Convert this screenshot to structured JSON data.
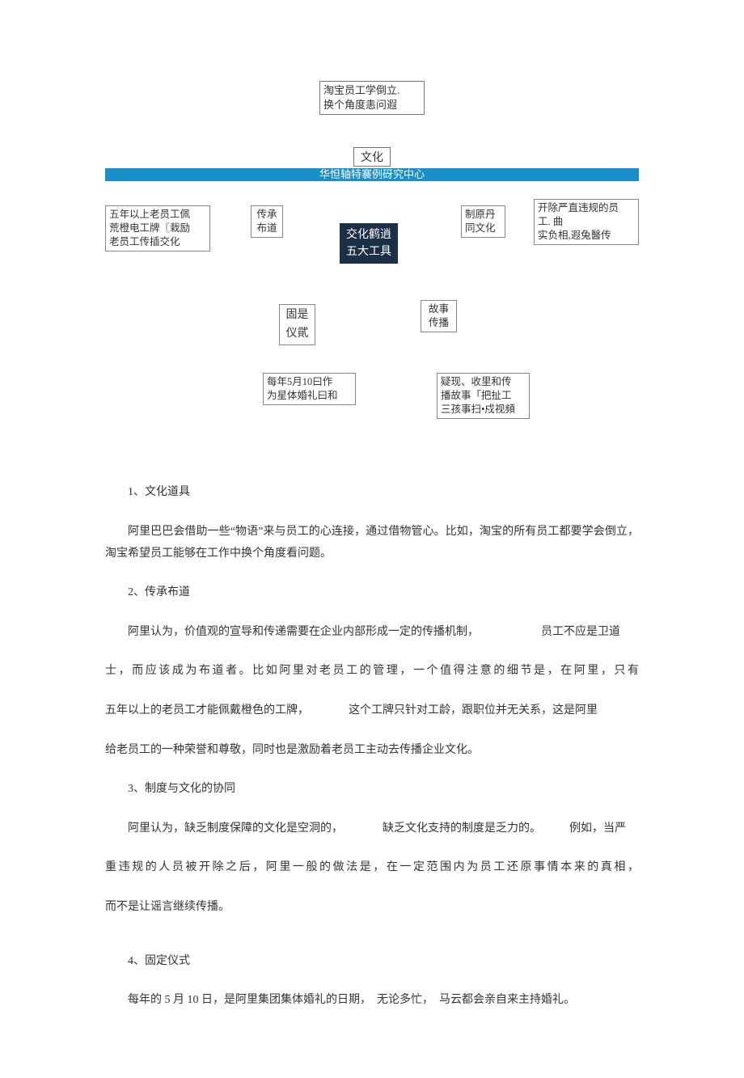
{
  "top_box": "淘宝员工学倒立.\n换个角度恚问遐",
  "culture_label": "文化",
  "blue_bar": "华怛轴特褰例砑究中心",
  "diagram": {
    "center": "交化鹤逍\n五大工具",
    "left_top": "五年以上老员工佩\n荒橙电工牌〖栽励\n老员工传插交化",
    "mid_left_top": "传承\n布道",
    "mid_right_top": "制原丹\n同文化",
    "right_top": "开除严直违规的员\n工. 曲\n实负相,遐兔醫传",
    "mid_left_bottom": "固是\n仪貮",
    "mid_right_bottom": "故事\n传播",
    "bottom_left": "每年5月10曰作\n为星体婚礼曰和",
    "bottom_right": "疑现、收里和传\n播故事「把扯工\n三孩事扫•戍视頻"
  },
  "body": {
    "h1": "1、文化道具",
    "p1": "阿里巴巴会借助一些“物语”来与员工的心连接，通过借物管心。比如，淘宝的所有员工都要学会倒立，淘宝希望员工能够在工作中换个角度看问题。",
    "h2": "2、传承布道",
    "p2a": "阿里认为，价值观的宣导和传递需要在企业内部形成一定的传播机制，　　　　　　员工不应是卫道",
    "p2b": "士，而应该成为布道者。比如阿里对老员工的管理，一个值得注意的细节是，在阿里，只有",
    "p2c": "五年以上的老员工才能佩戴橙色的工牌，　　　　这个工牌只针对工龄，跟职位并无关系，这是阿里",
    "p2d": "给老员工的一种荣誉和尊敬，同时也是激励着老员工主动去传播企业文化。",
    "h3": "3、制度与文化的协同",
    "p3a": "阿里认为，缺乏制度保障的文化是空洞的，　　　　缺乏文化支持的制度是乏力的。　　　例如，当严",
    "p3b": "重违规的人员被开除之后，阿里一般的做法是，在一定范围内为员工还原事情本来的真相，",
    "p3c": "而不是让谣言继续传播。",
    "h4": "4、固定仪式",
    "p4": "每年的 5 月 10 日，是阿里集团集体婚礼的日期，　无论多忙，　马云都会亲自来主持婚礼。"
  }
}
